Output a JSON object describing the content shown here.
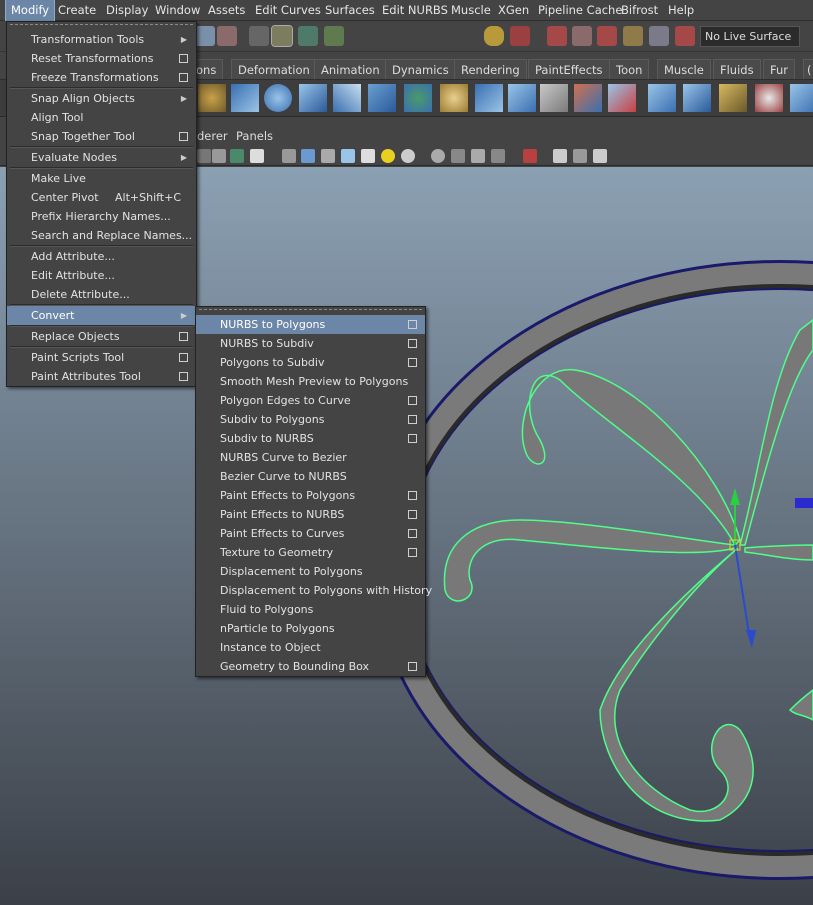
{
  "menubar": {
    "items": [
      "Modify",
      "Create",
      "Display",
      "Window",
      "Assets",
      "Edit Curves",
      "Surfaces",
      "Edit NURBS",
      "Muscle",
      "XGen",
      "Pipeline Cache",
      "Bifrost",
      "Help"
    ]
  },
  "toolbar": {
    "live_surface": "No Live Surface"
  },
  "shelf": {
    "tabs": [
      "ons",
      "Deformation",
      "Animation",
      "Dynamics",
      "Rendering",
      "PaintEffects",
      "Toon",
      "Muscle",
      "Fluids",
      "Fur",
      "("
    ]
  },
  "viewport_menu": {
    "items": [
      "derer",
      "Panels"
    ]
  },
  "modify_menu": {
    "items": [
      {
        "label": "Transformation Tools",
        "type": "sub"
      },
      {
        "label": "Reset Transformations",
        "type": "opt"
      },
      {
        "label": "Freeze Transformations",
        "type": "opt"
      },
      {
        "label": "Snap Align Objects",
        "type": "sub"
      },
      {
        "label": "Align Tool",
        "type": "none"
      },
      {
        "label": "Snap Together Tool",
        "type": "opt"
      },
      {
        "label": "Evaluate Nodes",
        "type": "sub"
      },
      {
        "label": "Make Live",
        "type": "none"
      },
      {
        "label": "Center Pivot",
        "type": "none",
        "accel": "Alt+Shift+C"
      },
      {
        "label": "Prefix Hierarchy Names...",
        "type": "none"
      },
      {
        "label": "Search and Replace Names...",
        "type": "none"
      },
      {
        "label": "Add Attribute...",
        "type": "none"
      },
      {
        "label": "Edit Attribute...",
        "type": "none"
      },
      {
        "label": "Delete Attribute...",
        "type": "none"
      },
      {
        "label": "Convert",
        "type": "sub",
        "highlight": true
      },
      {
        "label": "Replace Objects",
        "type": "opt"
      },
      {
        "label": "Paint Scripts Tool",
        "type": "opt"
      },
      {
        "label": "Paint Attributes Tool",
        "type": "opt"
      }
    ]
  },
  "convert_menu": {
    "items": [
      {
        "label": "NURBS to Polygons",
        "opt": true,
        "highlight": true
      },
      {
        "label": "NURBS to Subdiv",
        "opt": true
      },
      {
        "label": "Polygons to Subdiv",
        "opt": true
      },
      {
        "label": "Smooth Mesh Preview to Polygons",
        "opt": false
      },
      {
        "label": "Polygon Edges to Curve",
        "opt": true
      },
      {
        "label": "Subdiv to Polygons",
        "opt": true
      },
      {
        "label": "Subdiv to NURBS",
        "opt": true
      },
      {
        "label": "NURBS Curve to Bezier",
        "opt": false
      },
      {
        "label": "Bezier Curve to NURBS",
        "opt": false
      },
      {
        "label": "Paint Effects to Polygons",
        "opt": true
      },
      {
        "label": "Paint Effects to NURBS",
        "opt": true
      },
      {
        "label": "Paint Effects to Curves",
        "opt": true
      },
      {
        "label": "Texture to Geometry",
        "opt": true
      },
      {
        "label": "Displacement to Polygons",
        "opt": false
      },
      {
        "label": "Displacement to Polygons with History",
        "opt": false
      },
      {
        "label": "Fluid to Polygons",
        "opt": false
      },
      {
        "label": "nParticle to Polygons",
        "opt": false
      },
      {
        "label": "Instance to Object",
        "opt": false
      },
      {
        "label": "Geometry to Bounding Box",
        "opt": true
      }
    ]
  },
  "colors": {
    "highlight": "#6b86a6",
    "wire_selected": "#4dff8a",
    "mesh": "#6e6e6e",
    "ring_edge": "#1a1a8a"
  }
}
